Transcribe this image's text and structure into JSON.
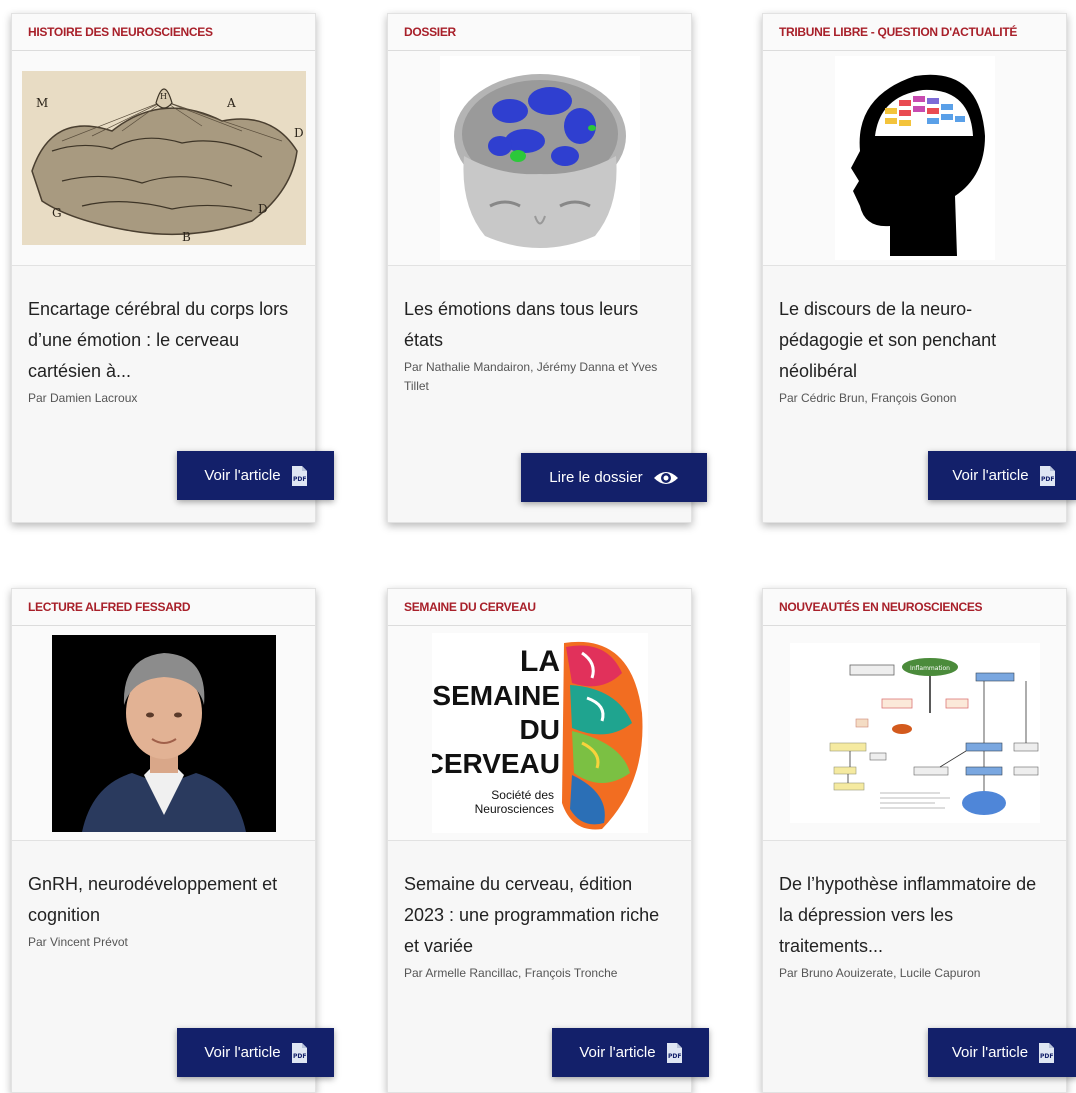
{
  "cards": [
    {
      "category": "HISTOIRE DES NEUROSCIENCES",
      "title": "Encartage cérébral du corps lors d’une émotion : le cerveau cartésien à...",
      "authors": "Par Damien Lacroux",
      "button": "Voir l'article",
      "image": "historical-brain-engraving",
      "engraving_letters": [
        "M",
        "H",
        "A",
        "D",
        "G",
        "B",
        "D"
      ]
    },
    {
      "category": "DOSSIER",
      "title": "Les émotions dans tous leurs états",
      "authors": "Par Nathalie Mandairon, Jérémy Danna et Yves Tillet",
      "button": "Lire le dossier",
      "image": "3d-brain-scan"
    },
    {
      "category": "TRIBUNE LIBRE - QUESTION D'ACTUALITÉ",
      "title": "Le discours de la neuro-pédagogie et son penchant néolibéral",
      "authors": "Par Cédric Brun, François Gonon",
      "button": "Voir l'article",
      "image": "head-silhouette-colored-brain"
    },
    {
      "category": "LECTURE ALFRED FESSARD",
      "title": "GnRH, neurodéveloppement et cognition",
      "authors": "Par Vincent Prévot",
      "button": "Voir l'article",
      "image": "portrait-photo"
    },
    {
      "category": "SEMAINE DU CERVEAU",
      "title": "Semaine du cerveau, édition 2023 : une programmation riche et variée",
      "authors": "Par Armelle Rancillac, François Tronche",
      "button": "Voir l'article",
      "image": "semaine-du-cerveau-logo",
      "logo_lines": [
        "LA",
        "SEMAINE",
        "DU",
        "CERVEAU"
      ],
      "logo_org": [
        "Société des",
        "Neurosciences"
      ]
    },
    {
      "category": "NOUVEAUTÉS EN NEUROSCIENCES",
      "title": "De l’hypothèse inflammatoire de la dépression vers les traitements...",
      "authors": "Par Bruno Aouizerate, Lucile Capuron",
      "button": "Voir l'article",
      "image": "inflammation-pathway-diagram",
      "diagram_center_label": "Inflammation"
    }
  ],
  "icons": {
    "pdf": "pdf-icon",
    "view": "eye-icon"
  },
  "colors": {
    "category": "#a8202a",
    "button_bg": "#13206a",
    "card_bg": "#f7f7f7"
  }
}
